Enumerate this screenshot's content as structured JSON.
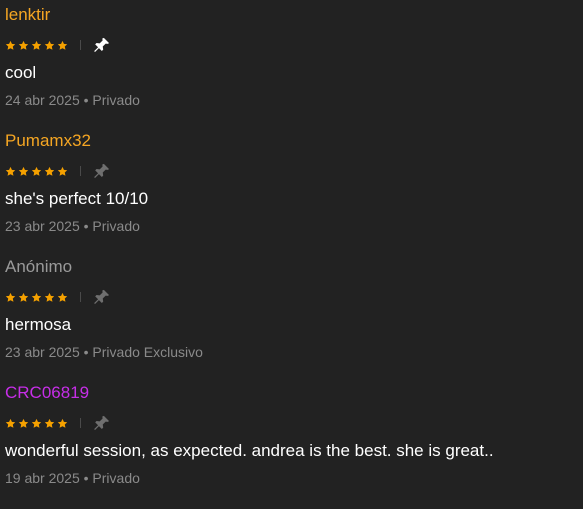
{
  "colors": {
    "background": "#222222",
    "star": "#f5a100",
    "meta_text": "#8a8a8a",
    "pin_active": "#ffffff",
    "pin_inactive": "#6f6f6f"
  },
  "reviews": [
    {
      "username": "lenktir",
      "username_color": "#f5a623",
      "rating": 5,
      "pinned": true,
      "comment": "cool",
      "date": "24 abr 2025",
      "separator": "•",
      "visibility": "Privado"
    },
    {
      "username": "Pumamx32",
      "username_color": "#f5a623",
      "rating": 5,
      "pinned": false,
      "comment": "she's perfect 10/10",
      "date": "23 abr 2025",
      "separator": "•",
      "visibility": "Privado"
    },
    {
      "username": "Anónimo",
      "username_color": "#9a9a9a",
      "rating": 5,
      "pinned": false,
      "comment": "hermosa",
      "date": "23 abr 2025",
      "separator": "•",
      "visibility": "Privado Exclusivo"
    },
    {
      "username": "CRC06819",
      "username_color": "#c72ee8",
      "rating": 5,
      "pinned": false,
      "comment": "wonderful session, as expected. andrea is the best. she is great..",
      "date": "19 abr 2025",
      "separator": "•",
      "visibility": "Privado"
    }
  ]
}
